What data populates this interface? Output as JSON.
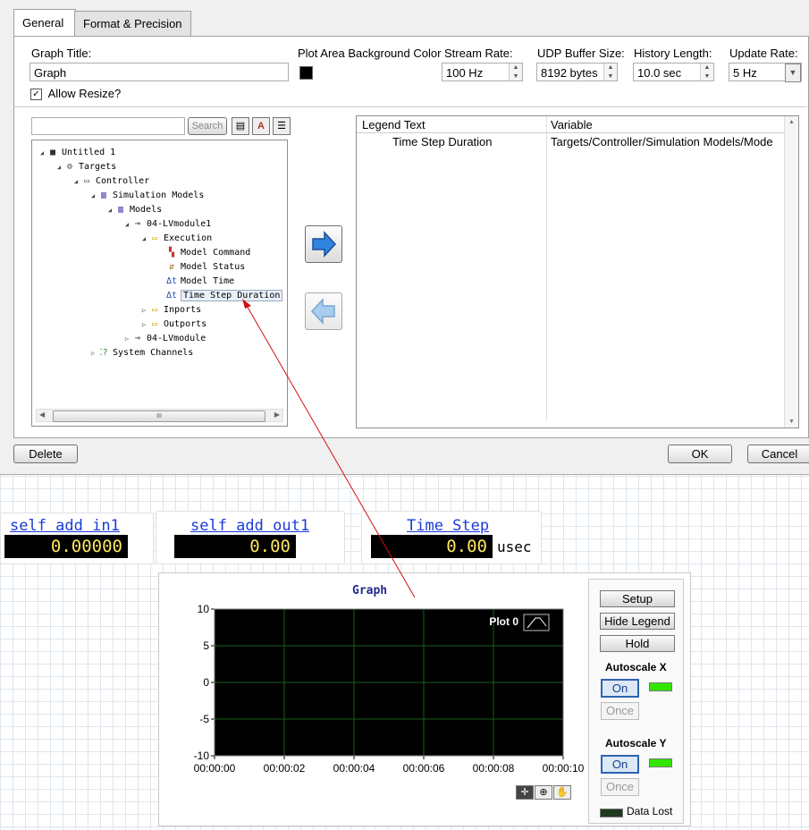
{
  "dialog": {
    "tabs": [
      {
        "label": "General",
        "active": true
      },
      {
        "label": "Format & Precision",
        "active": false
      }
    ],
    "graph_title_label": "Graph Title:",
    "graph_title_value": "Graph",
    "bg_color_label": "Plot Area Background Color",
    "bg_color": "#000000",
    "stream_rate_label": "Stream Rate:",
    "stream_rate_value": "100 Hz",
    "udp_buffer_label": "UDP Buffer Size:",
    "udp_buffer_value": "8192 bytes",
    "history_label": "History Length:",
    "history_value": "10.0 sec",
    "update_rate_label": "Update Rate:",
    "update_rate_value": "5 Hz",
    "allow_resize_label": "Allow Resize?",
    "allow_resize_checked": true,
    "search_placeholder": "",
    "search_button": "Search",
    "tree": [
      {
        "label": "Untitled 1",
        "level": 0,
        "icon": "project-icon",
        "expanded": true
      },
      {
        "label": "Targets",
        "level": 1,
        "icon": "targets-icon",
        "expanded": true
      },
      {
        "label": "Controller",
        "level": 2,
        "icon": "controller-icon",
        "expanded": true
      },
      {
        "label": "Simulation Models",
        "level": 3,
        "icon": "books-icon",
        "expanded": true
      },
      {
        "label": "Models",
        "level": 4,
        "icon": "books-icon",
        "expanded": true
      },
      {
        "label": "04-LVmodule1",
        "level": 5,
        "icon": "module-icon",
        "expanded": true
      },
      {
        "label": "Execution",
        "level": 6,
        "icon": "folder-icon",
        "expanded": true
      },
      {
        "label": "Model Command",
        "level": 7,
        "icon": "command-icon",
        "expanded": null
      },
      {
        "label": "Model Status",
        "level": 7,
        "icon": "status-icon",
        "expanded": null
      },
      {
        "label": "Model Time",
        "level": 7,
        "icon": "delta-t-icon",
        "expanded": null
      },
      {
        "label": "Time Step Duration",
        "level": 7,
        "icon": "delta-t-icon",
        "expanded": null,
        "selected": true
      },
      {
        "label": "Inports",
        "level": 6,
        "icon": "folder-icon",
        "expanded": false
      },
      {
        "label": "Outports",
        "level": 6,
        "icon": "folder-icon",
        "expanded": false
      },
      {
        "label": "04-LVmodule",
        "level": 5,
        "icon": "module-icon",
        "expanded": false
      },
      {
        "label": "System Channels",
        "level": 3,
        "icon": "channels-icon",
        "expanded": false
      }
    ],
    "hscroll_grip": "III",
    "legend_columns": [
      "Legend Text",
      "Variable"
    ],
    "legend_rows": [
      {
        "legend": "Time Step Duration",
        "variable": "Targets/Controller/Simulation Models/Mode"
      }
    ],
    "delete_button": "Delete",
    "ok_button": "OK",
    "cancel_button": "Cancel"
  },
  "indicators": [
    {
      "label": "self add in1",
      "value": "0.00000",
      "unit": ""
    },
    {
      "label": "self add out1",
      "value": "0.00",
      "unit": ""
    },
    {
      "label": "Time Step",
      "value": "0.00",
      "unit": "usec"
    }
  ],
  "graph": {
    "setup_button": "Setup",
    "hide_legend_button": "Hide Legend",
    "hold_button": "Hold",
    "autoscale_x_label": "Autoscale X",
    "autoscale_y_label": "Autoscale Y",
    "on_label": "On",
    "once_label": "Once",
    "data_lost_label": "Data Lost",
    "led_on_color": "#33e600",
    "led_off_color": "#1f3a1f"
  },
  "chart_data": {
    "type": "line",
    "title": "Graph",
    "xlabel": "",
    "ylabel": "",
    "x_tick_labels": [
      "00:00:00",
      "00:00:02",
      "00:00:04",
      "00:00:06",
      "00:00:08",
      "00:00:10"
    ],
    "y_ticks": [
      10,
      5,
      0,
      -5,
      -10
    ],
    "xlim": [
      0,
      10
    ],
    "ylim": [
      -10,
      10
    ],
    "grid": true,
    "background": "#000000",
    "grid_color": "#1d5e1d",
    "legend_placement": "top-right",
    "series": [
      {
        "name": "Plot 0",
        "values": []
      }
    ]
  }
}
